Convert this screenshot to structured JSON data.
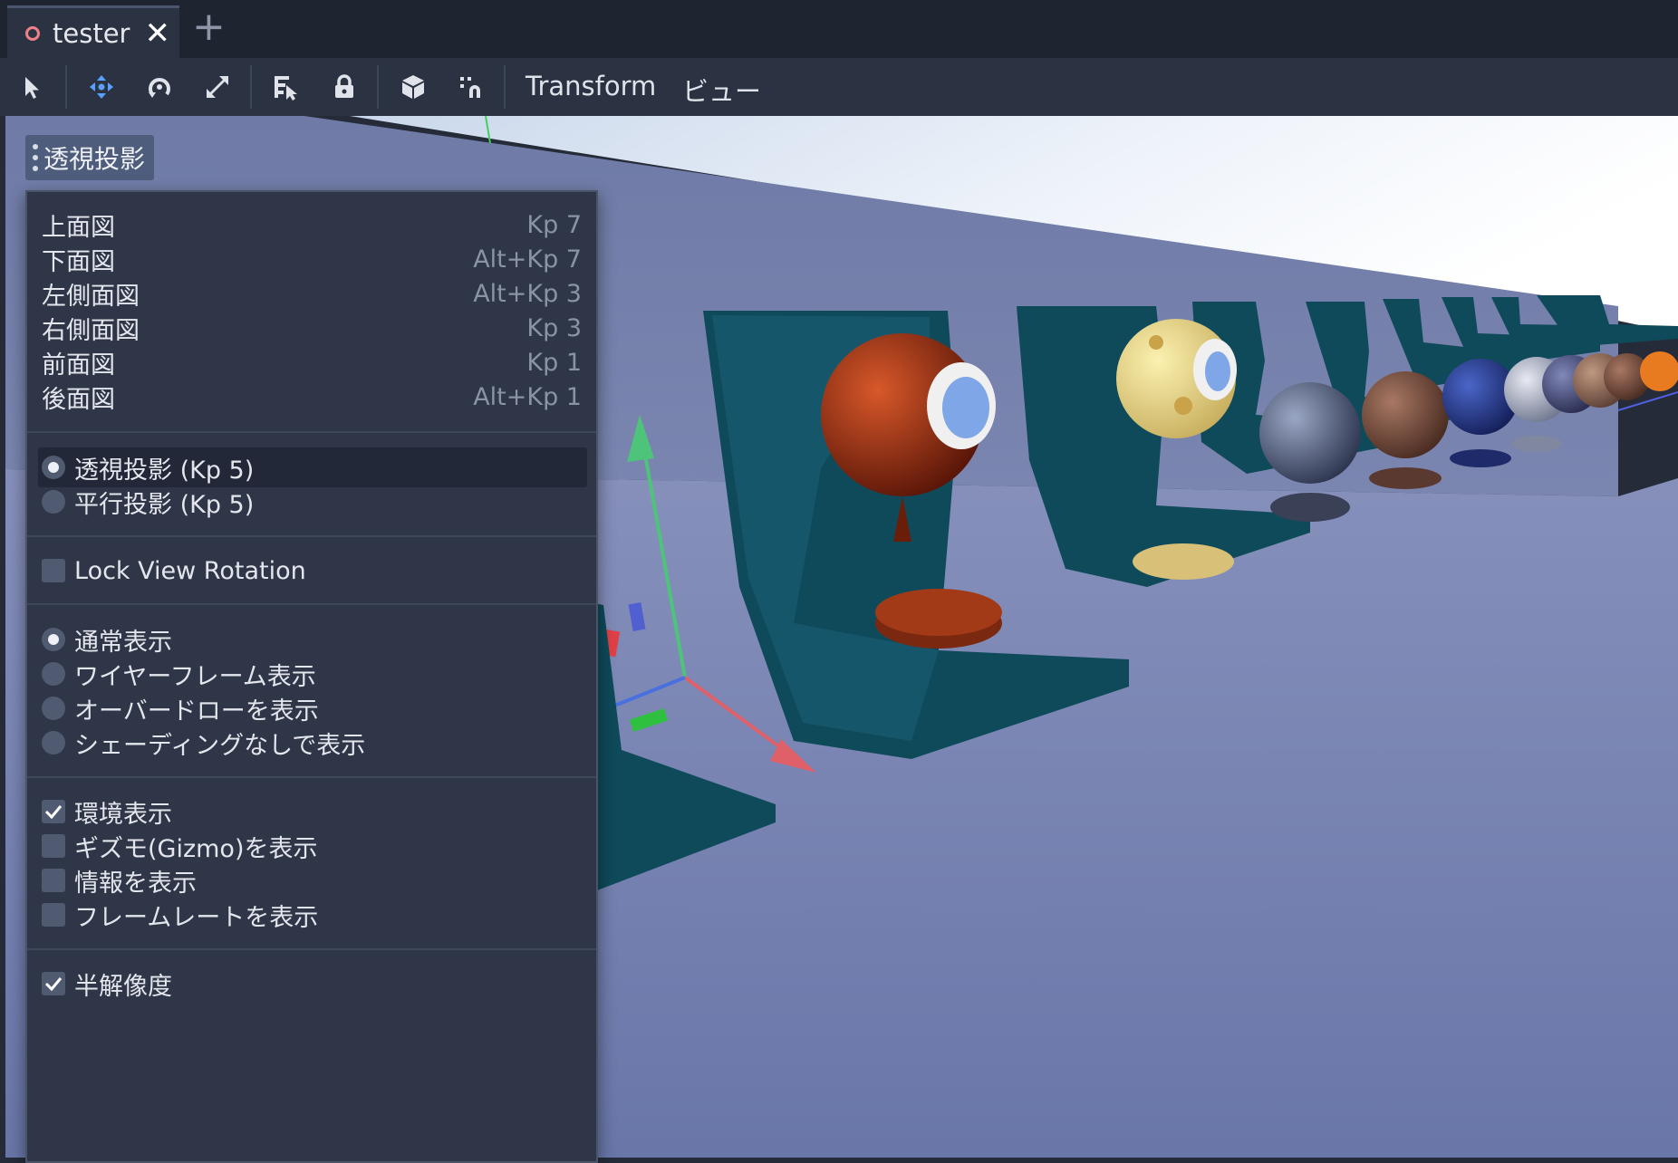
{
  "tabs": [
    {
      "label": "tester",
      "icon": "scene-icon"
    }
  ],
  "toolbar": {
    "tools": [
      "select-tool-icon",
      "move-tool-icon",
      "rotate-tool-icon",
      "scale-tool-icon",
      "list-select-icon",
      "lock-icon",
      "cube-icon",
      "snap-icon"
    ],
    "transform_menu": "Transform",
    "view_menu": "ビュー"
  },
  "viewport": {
    "view_menu_button": "透視投影"
  },
  "popup": {
    "views": [
      {
        "label": "上面図",
        "shortcut": "Kp 7"
      },
      {
        "label": "下面図",
        "shortcut": "Alt+Kp 7"
      },
      {
        "label": "左側面図",
        "shortcut": "Alt+Kp 3"
      },
      {
        "label": "右側面図",
        "shortcut": "Kp 3"
      },
      {
        "label": "前面図",
        "shortcut": "Kp 1"
      },
      {
        "label": "後面図",
        "shortcut": "Alt+Kp 1"
      }
    ],
    "projection": [
      {
        "label": "透視投影 (Kp 5)",
        "selected": true
      },
      {
        "label": "平行投影 (Kp 5)",
        "selected": false
      }
    ],
    "lock_view_rotation": {
      "label": "Lock View Rotation",
      "checked": false
    },
    "display_modes": [
      {
        "label": "通常表示",
        "selected": true
      },
      {
        "label": "ワイヤーフレーム表示",
        "selected": false
      },
      {
        "label": "オーバードローを表示",
        "selected": false
      },
      {
        "label": "シェーディングなしで表示",
        "selected": false
      }
    ],
    "toggles": [
      {
        "label": "環境表示",
        "checked": true
      },
      {
        "label": "ギズモ(Gizmo)を表示",
        "checked": false
      },
      {
        "label": "情報を表示",
        "checked": false
      },
      {
        "label": "フレームレートを表示",
        "checked": false
      }
    ],
    "half_resolution": {
      "label": "半解像度",
      "checked": true
    }
  },
  "colors": {
    "accent": "#5aa0ff",
    "tab_icon": "#f0808a",
    "menu_bg": "#2f3647",
    "toolbar_bg": "#2b3242"
  }
}
